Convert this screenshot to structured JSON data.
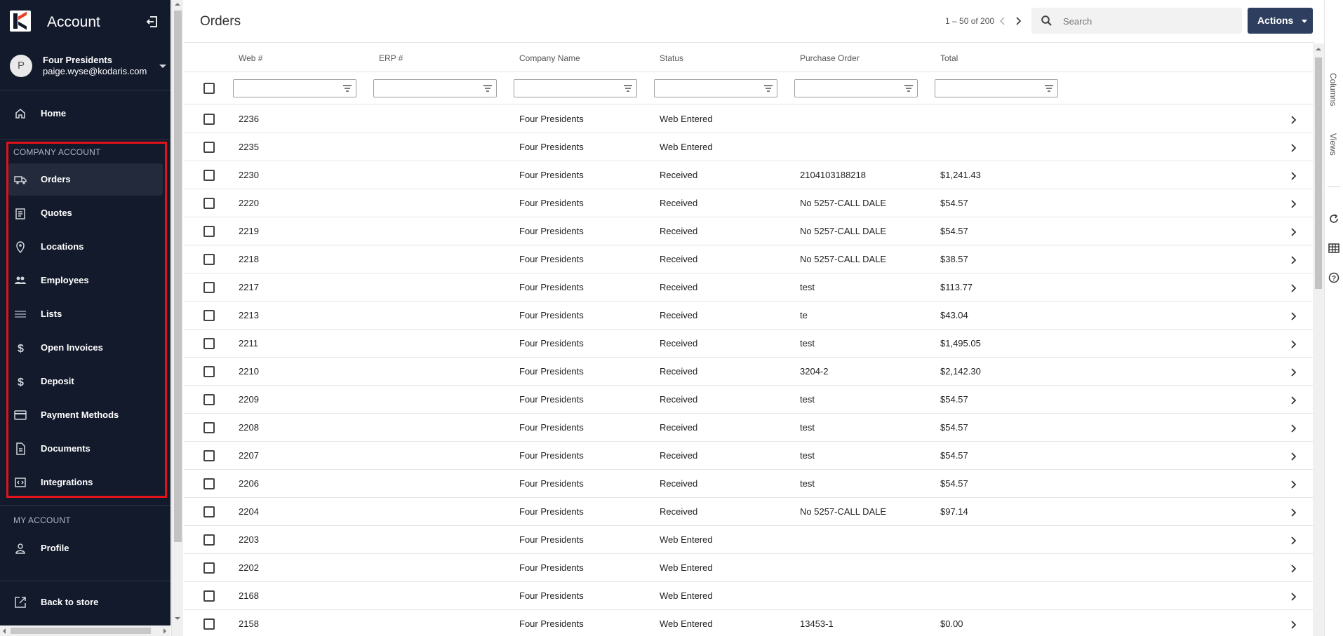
{
  "sidebar": {
    "app_title": "Account",
    "user": {
      "initial": "P",
      "name": "Four Presidents",
      "email": "paige.wyse@kodaris.com"
    },
    "home_label": "Home",
    "company_section_label": "COMPANY ACCOUNT",
    "company_items": [
      {
        "label": "Orders",
        "icon": "truck-icon",
        "active": true
      },
      {
        "label": "Quotes",
        "icon": "clipboard-icon"
      },
      {
        "label": "Locations",
        "icon": "map-pin-icon"
      },
      {
        "label": "Employees",
        "icon": "people-icon"
      },
      {
        "label": "Lists",
        "icon": "list-icon"
      },
      {
        "label": "Open Invoices",
        "icon": "dollar-icon"
      },
      {
        "label": "Deposit",
        "icon": "dollar-icon"
      },
      {
        "label": "Payment Methods",
        "icon": "credit-card-icon"
      },
      {
        "label": "Documents",
        "icon": "document-icon"
      },
      {
        "label": "Integrations",
        "icon": "integration-icon"
      }
    ],
    "my_section_label": "MY ACCOUNT",
    "profile_label": "Profile",
    "back_label": "Back to store",
    "highlight_color": "#e2121b"
  },
  "main": {
    "title": "Orders",
    "pager_text": "1 – 50 of 200",
    "search_placeholder": "Search",
    "actions_label": "Actions",
    "columns": [
      "Web #",
      "ERP #",
      "Company Name",
      "Status",
      "Purchase Order",
      "Total"
    ],
    "rows": [
      {
        "web": "2236",
        "erp": "",
        "company": "Four Presidents",
        "status": "Web Entered",
        "po": "",
        "total": ""
      },
      {
        "web": "2235",
        "erp": "",
        "company": "Four Presidents",
        "status": "Web Entered",
        "po": "",
        "total": ""
      },
      {
        "web": "2230",
        "erp": "",
        "company": "Four Presidents",
        "status": "Received",
        "po": "2104103188218",
        "total": "$1,241.43"
      },
      {
        "web": "2220",
        "erp": "",
        "company": "Four Presidents",
        "status": "Received",
        "po": "No 5257-CALL DALE",
        "total": "$54.57"
      },
      {
        "web": "2219",
        "erp": "",
        "company": "Four Presidents",
        "status": "Received",
        "po": "No 5257-CALL DALE",
        "total": "$54.57"
      },
      {
        "web": "2218",
        "erp": "",
        "company": "Four Presidents",
        "status": "Received",
        "po": "No 5257-CALL DALE",
        "total": "$38.57"
      },
      {
        "web": "2217",
        "erp": "",
        "company": "Four Presidents",
        "status": "Received",
        "po": "test",
        "total": "$113.77"
      },
      {
        "web": "2213",
        "erp": "",
        "company": "Four Presidents",
        "status": "Received",
        "po": "te",
        "total": "$43.04"
      },
      {
        "web": "2211",
        "erp": "",
        "company": "Four Presidents",
        "status": "Received",
        "po": "test",
        "total": "$1,495.05"
      },
      {
        "web": "2210",
        "erp": "",
        "company": "Four Presidents",
        "status": "Received",
        "po": "3204-2",
        "total": "$2,142.30"
      },
      {
        "web": "2209",
        "erp": "",
        "company": "Four Presidents",
        "status": "Received",
        "po": "test",
        "total": "$54.57"
      },
      {
        "web": "2208",
        "erp": "",
        "company": "Four Presidents",
        "status": "Received",
        "po": "test",
        "total": "$54.57"
      },
      {
        "web": "2207",
        "erp": "",
        "company": "Four Presidents",
        "status": "Received",
        "po": "test",
        "total": "$54.57"
      },
      {
        "web": "2206",
        "erp": "",
        "company": "Four Presidents",
        "status": "Received",
        "po": "test",
        "total": "$54.57"
      },
      {
        "web": "2204",
        "erp": "",
        "company": "Four Presidents",
        "status": "Received",
        "po": "No 5257-CALL DALE",
        "total": "$97.14"
      },
      {
        "web": "2203",
        "erp": "",
        "company": "Four Presidents",
        "status": "Web Entered",
        "po": "",
        "total": ""
      },
      {
        "web": "2202",
        "erp": "",
        "company": "Four Presidents",
        "status": "Web Entered",
        "po": "",
        "total": ""
      },
      {
        "web": "2168",
        "erp": "",
        "company": "Four Presidents",
        "status": "Web Entered",
        "po": "",
        "total": ""
      },
      {
        "web": "2158",
        "erp": "",
        "company": "Four Presidents",
        "status": "Web Entered",
        "po": "13453-1",
        "total": "$0.00"
      }
    ]
  },
  "side_panel": {
    "tabs": [
      "Columns",
      "Views"
    ],
    "icons": [
      "refresh-icon",
      "table-icon",
      "help-icon"
    ]
  }
}
